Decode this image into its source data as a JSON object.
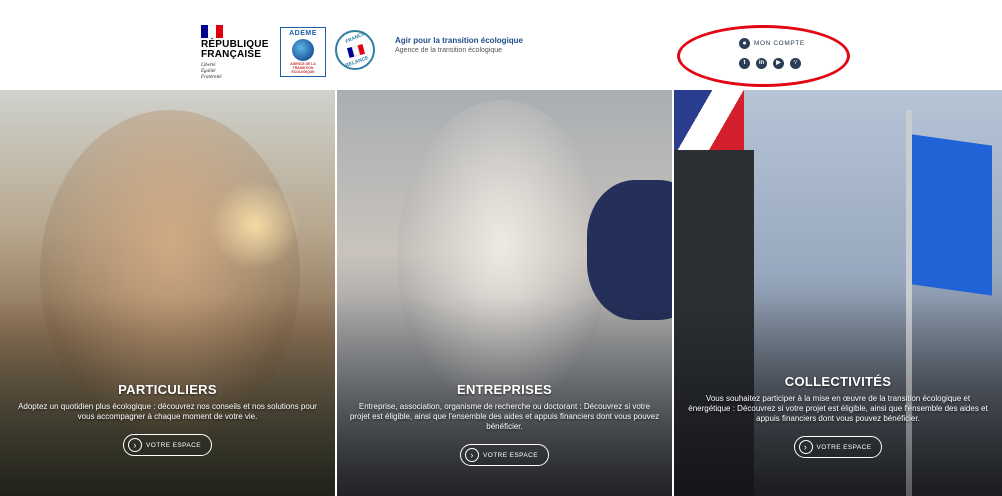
{
  "header": {
    "republique": {
      "name_line1": "RÉPUBLIQUE",
      "name_line2": "FRANÇAISE",
      "motto_line1": "Liberté",
      "motto_line2": "Égalité",
      "motto_line3": "Fraternité"
    },
    "ademe": {
      "title": "ADEME",
      "subtitle": "AGENCE DE LA TRANSITION ÉCOLOGIQUE"
    },
    "relance": {
      "top": "FRANCE",
      "bottom": "RELANCE"
    },
    "tagline": {
      "title": "Agir pour la transition écologique",
      "subtitle": "Agence de la transition écologique"
    },
    "account": {
      "label": "MON COMPTE"
    },
    "socials": [
      "twitter-icon",
      "linkedin-icon",
      "youtube-icon",
      "rss-icon"
    ],
    "highlight_color": "#e30613"
  },
  "panels": [
    {
      "title": "PARTICULIERS",
      "description": "Adoptez un quotidien plus écologique : découvrez nos conseils et nos solutions pour vous accompagner à chaque moment de votre vie.",
      "button": "VOTRE ESPACE"
    },
    {
      "title": "ENTREPRISES",
      "description": "Entreprise, association, organisme de recherche ou doctorant : Découvrez si votre projet est éligible, ainsi que l'ensemble des aides et appuis financiers dont vous pouvez bénéficier.",
      "button": "VOTRE ESPACE"
    },
    {
      "title": "COLLECTIVITÉS",
      "description": "Vous souhaitez participer à la mise en œuvre de la transition écologique et énergétique : Découvrez si votre projet est éligible, ainsi que l'ensemble des aides et appuis financiers dont vous pouvez bénéficier.",
      "button": "VOTRE ESPACE"
    }
  ]
}
